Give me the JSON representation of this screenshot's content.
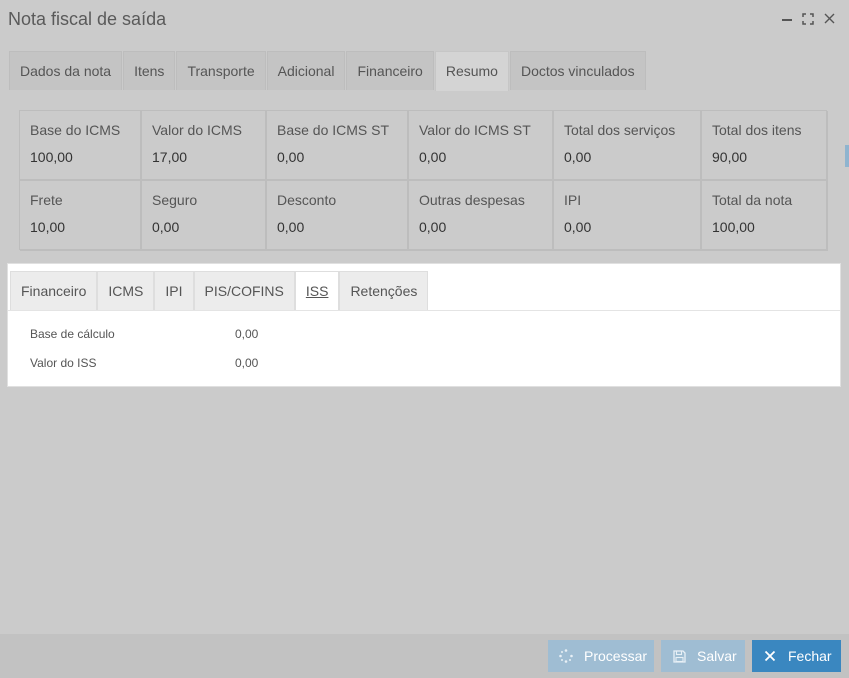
{
  "window": {
    "title": "Nota fiscal de saída"
  },
  "main_tabs": [
    {
      "label": "Dados da nota",
      "active": false
    },
    {
      "label": "Itens",
      "active": false
    },
    {
      "label": "Transporte",
      "active": false
    },
    {
      "label": "Adicional",
      "active": false
    },
    {
      "label": "Financeiro",
      "active": false
    },
    {
      "label": "Resumo",
      "active": true
    },
    {
      "label": "Doctos vinculados",
      "active": false
    }
  ],
  "summary": [
    {
      "label": "Base do ICMS",
      "value": "100,00"
    },
    {
      "label": "Valor do ICMS",
      "value": "17,00"
    },
    {
      "label": "Base do ICMS ST",
      "value": "0,00"
    },
    {
      "label": "Valor do ICMS ST",
      "value": "0,00"
    },
    {
      "label": "Total dos serviços",
      "value": "0,00"
    },
    {
      "label": "Total dos itens",
      "value": "90,00"
    },
    {
      "label": "Frete",
      "value": "10,00"
    },
    {
      "label": "Seguro",
      "value": "0,00"
    },
    {
      "label": "Desconto",
      "value": "0,00"
    },
    {
      "label": "Outras despesas",
      "value": "0,00"
    },
    {
      "label": "IPI",
      "value": "0,00"
    },
    {
      "label": "Total da nota",
      "value": "100,00"
    }
  ],
  "sub_tabs": [
    {
      "label": "Financeiro",
      "active": false
    },
    {
      "label": "ICMS",
      "active": false
    },
    {
      "label": "IPI",
      "active": false
    },
    {
      "label": "PIS/COFINS",
      "active": false
    },
    {
      "label": "ISS",
      "active": true
    },
    {
      "label": "Retenções",
      "active": false
    }
  ],
  "iss": {
    "rows": [
      {
        "label": "Base de cálculo",
        "value": "0,00"
      },
      {
        "label": "Valor do ISS",
        "value": "0,00"
      }
    ]
  },
  "footer": {
    "process_label": "Processar",
    "save_label": "Salvar",
    "close_label": "Fechar"
  },
  "colors": {
    "background": "#cbcbcb",
    "primary_button": "#3a87c0",
    "disabled_button": "#9fbdd3",
    "panel": "#ffffff"
  },
  "icons": {
    "process": "spinner-icon",
    "save": "floppy-disk-icon",
    "close": "close-icon"
  }
}
